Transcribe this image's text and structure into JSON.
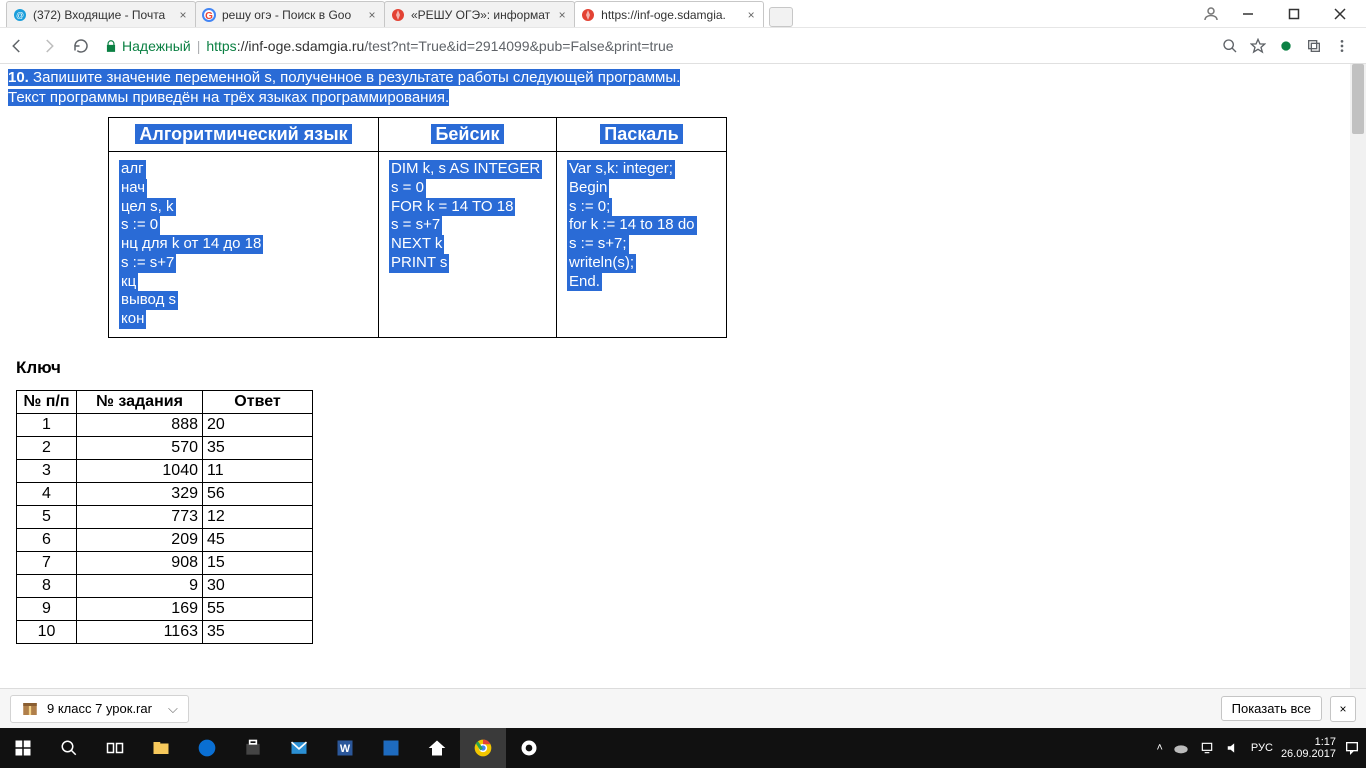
{
  "browser": {
    "tabs": [
      {
        "title": "(372) Входящие - Почта",
        "icon_color": "#1a9edb"
      },
      {
        "title": "решу огэ - Поиск в Goo",
        "icon_letter": "G"
      },
      {
        "title": "«РЕШУ ОГЭ»: информат",
        "icon_color": "#e34234"
      },
      {
        "title": "https://inf-oge.sdamgia.",
        "icon_color": "#e34234"
      }
    ],
    "secure_label": "Надежный",
    "url_scheme": "https",
    "url_host": "://inf-oge.sdamgia.ru",
    "url_path": "/test?nt=True&id=2914099&pub=False&print=true"
  },
  "problem": {
    "number": "10.",
    "line1": " Запишите значение переменной s, полученное в результате работы следующей программы.",
    "line2": "Текст программы приведён на трёх языках программирования."
  },
  "code_headers": [
    "Алгоритмический язык",
    "Бейсик",
    "Паскаль"
  ],
  "code_lines": {
    "alg": [
      "алг",
      "нач",
      "цел s, k",
      "s := 0",
      "нц для k от 14 до 18",
      "s := s+7",
      "кц",
      "вывод s",
      "кон"
    ],
    "basic": [
      "DIM k, s AS INTEGER",
      "s = 0",
      "FOR k = 14 TO 18",
      "s = s+7",
      "NEXT k",
      "PRINT s"
    ],
    "pascal": [
      "Var s,k: integer;",
      "Begin",
      "s := 0;",
      "for k := 14 to 18 do",
      "s := s+7;",
      "writeln(s);",
      "End."
    ]
  },
  "key_heading": "Ключ",
  "ans_headers": [
    "№ п/п",
    "№ задания",
    "Ответ"
  ],
  "answers": [
    {
      "n": "1",
      "task": "888",
      "ans": "20"
    },
    {
      "n": "2",
      "task": "570",
      "ans": "35"
    },
    {
      "n": "3",
      "task": "1040",
      "ans": "11"
    },
    {
      "n": "4",
      "task": "329",
      "ans": "56"
    },
    {
      "n": "5",
      "task": "773",
      "ans": "12"
    },
    {
      "n": "6",
      "task": "209",
      "ans": "45"
    },
    {
      "n": "7",
      "task": "908",
      "ans": "15"
    },
    {
      "n": "8",
      "task": "9",
      "ans": "30"
    },
    {
      "n": "9",
      "task": "169",
      "ans": "55"
    },
    {
      "n": "10",
      "task": "1163",
      "ans": "35"
    }
  ],
  "downloads": {
    "filename": "9 класс 7 урок.rar",
    "show_all": "Показать все"
  },
  "tray": {
    "lang": "РУС",
    "time": "1:17",
    "date": "26.09.2017"
  }
}
